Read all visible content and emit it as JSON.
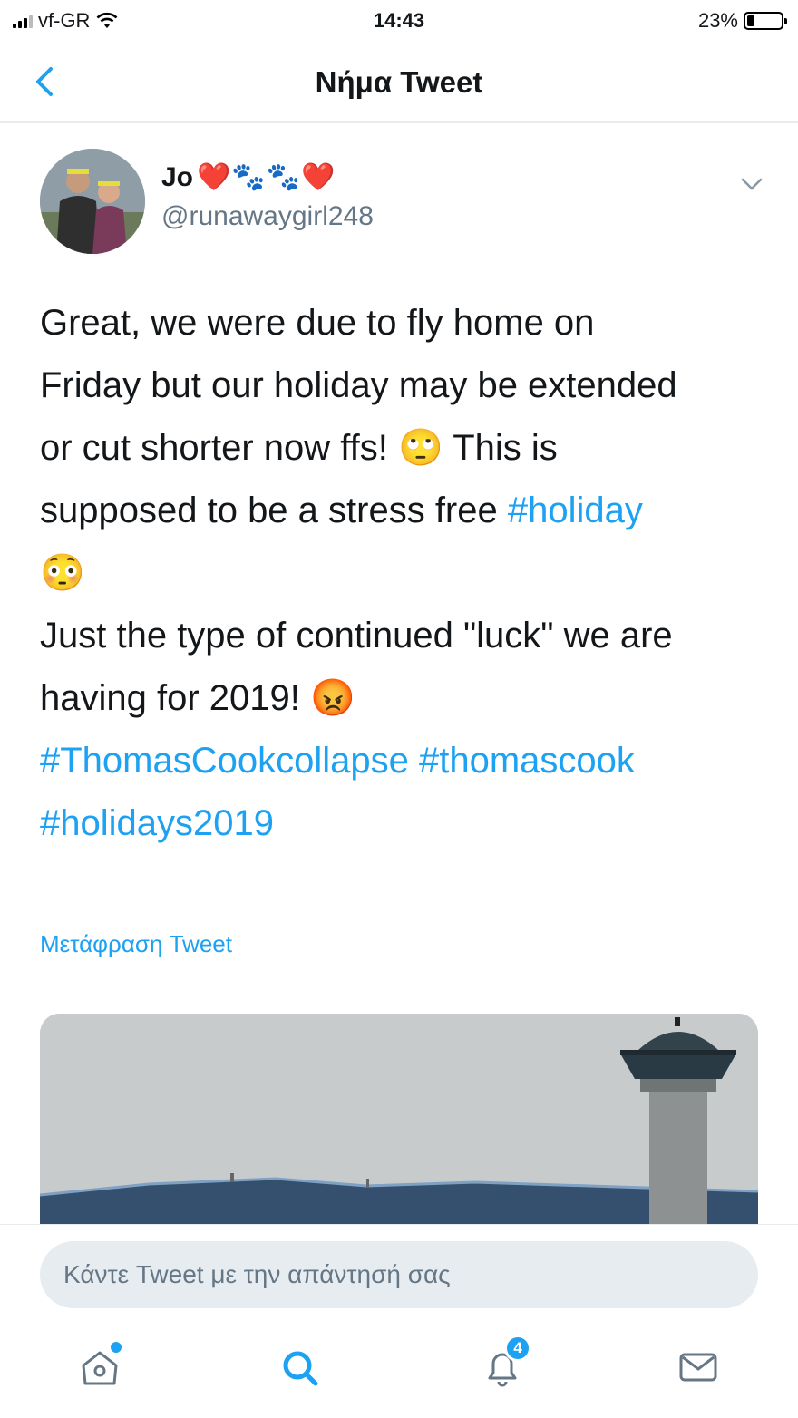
{
  "status_bar": {
    "carrier": "vf-GR",
    "time": "14:43",
    "battery": "23%",
    "battery_level": 0.23
  },
  "nav": {
    "title": "Νήμα Tweet",
    "back_icon": "chevron-left-icon"
  },
  "tweet": {
    "user": {
      "name": "Jo",
      "name_emojis": "❤️🐾🐾❤️",
      "handle": "@runawaygirl248"
    },
    "body": {
      "line1": "Great, we were due to fly home on",
      "line2": "Friday but our holiday may be extended",
      "line3_text": "or cut shorter now ffs! ",
      "line3_emoji": "🙄",
      "line3_rest": " This is",
      "line4_text": "supposed to be a stress free ",
      "line4_hashtag": "#holiday",
      "line5_emoji": "😳",
      "line6": "Just the type of continued \"luck\" we are",
      "line7_text": "having for 2019! ",
      "line7_emoji": "😡",
      "hashtag1": "#ThomasCookcollapse",
      "hashtag2": "#thomascook",
      "hashtag3": "#holidays2019"
    },
    "translate_label": "Μετάφραση Tweet"
  },
  "reply": {
    "placeholder": "Κάντε Tweet με την απάντησή σας"
  },
  "tab_bar": {
    "notification_count": "4",
    "accent_color": "#1da1f2",
    "icons": [
      "home-icon",
      "search-icon",
      "notifications-icon",
      "messages-icon"
    ]
  }
}
